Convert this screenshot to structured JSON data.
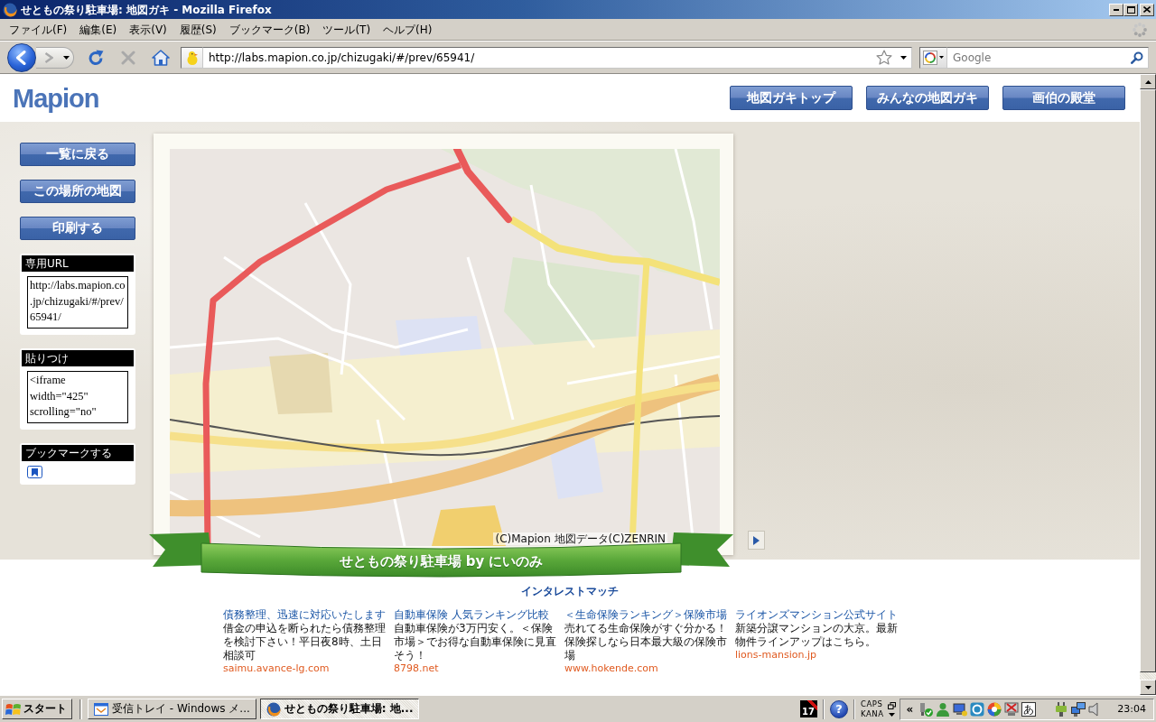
{
  "window": {
    "title": "せともの祭り駐車場: 地図ガキ - Mozilla Firefox"
  },
  "menu_bar": {
    "items": [
      "ファイル(F)",
      "編集(E)",
      "表示(V)",
      "履歴(S)",
      "ブックマーク(B)",
      "ツール(T)",
      "ヘルプ(H)"
    ]
  },
  "toolbar": {
    "buttons": [
      {
        "kind": "back",
        "disabled": false
      },
      {
        "kind": "forward",
        "disabled": true
      },
      {
        "kind": "history",
        "disabled": false
      },
      {
        "kind": "reload",
        "disabled": false
      },
      {
        "kind": "stop",
        "disabled": true
      },
      {
        "kind": "home",
        "disabled": false
      }
    ],
    "url": "http://labs.mapion.co.jp/chizugaki/#/prev/65941/",
    "search": {
      "placeholder": "Google"
    }
  },
  "page": {
    "logo": "Mapion",
    "nav_buttons": [
      "地図ガキトップ",
      "みんなの地図ガキ",
      "画伯の殿堂"
    ],
    "sidebar": {
      "buttons": [
        "一覧に戻る",
        "この場所の地図",
        "印刷する"
      ],
      "panels": [
        {
          "kind": "textbox",
          "title": "専用URL",
          "value": "http://labs.mapion.co.jp/chizugaki/#/prev/65941/"
        },
        {
          "kind": "textbox",
          "title": "貼りつけ",
          "value": "<iframe width=\"425\" scrolling=\"no\""
        },
        {
          "kind": "bookmark",
          "title": "ブックマークする"
        }
      ]
    },
    "map": {
      "copyright": "(C)Mapion 地図データ(C)ZENRIN",
      "banner": "せともの祭り駐車場 by にいのみ"
    },
    "ads": {
      "heading": "インタレストマッチ",
      "items": [
        {
          "title": "債務整理、迅速に対応いたします",
          "text": "借金の申込を断られたら債務整理を検討下さい！平日夜8時、土日相談可",
          "url": "saimu.avance-lg.com"
        },
        {
          "title": "自動車保険 人気ランキング比較",
          "text": "自動車保険が3万円安く。＜保険市場＞でお得な自動車保険に見直そう！",
          "url": "8798.net"
        },
        {
          "title": "＜生命保険ランキング＞保険市場",
          "text": "売れてる生命保険がすぐ分かる！保険探しなら日本最大級の保険市場",
          "url": "www.hokende.com"
        },
        {
          "title": "ライオンズマンション公式サイト",
          "text": "新築分譲マンションの大京。最新物件ラインアップはこちら。",
          "url": "lions-mansion.jp"
        }
      ]
    }
  },
  "taskbar": {
    "start": "スタート",
    "tasks": [
      {
        "kind": "mail",
        "label": "受信トレイ - Windows メ...",
        "selected": false
      },
      {
        "kind": "browser",
        "label": "せともの祭り駐車場: 地...",
        "selected": true
      }
    ],
    "tray": {
      "calendar_day": "17",
      "help": "?",
      "indicators": [
        "CAPS",
        "KANA"
      ],
      "expand": "«",
      "ime": "あ",
      "clock": "23:04"
    }
  }
}
